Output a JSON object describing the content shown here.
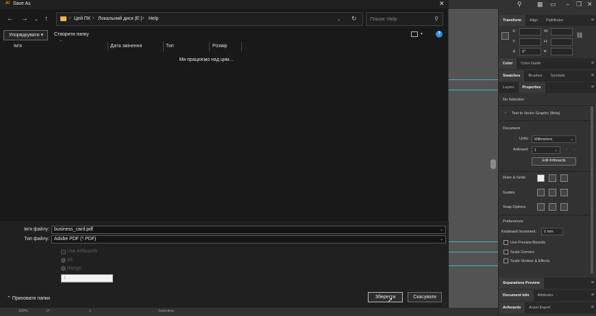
{
  "dialog": {
    "title": "Save As",
    "app_badge": "Ai",
    "close_glyph": "✕",
    "breadcrumb": [
      "Цей ПК",
      "Локальний диск (E:)",
      "Help"
    ],
    "search_placeholder": "Пошук: Help",
    "organize_label": "Упорядкувати ▾",
    "new_folder_label": "Створити папку",
    "help_glyph": "?",
    "columns": [
      "Ім'я",
      "Дата змінення",
      "Тип",
      "Розмір"
    ],
    "empty_message": "Ми працюємо над цим...",
    "filename_label": "Ім'я файлу:",
    "filename_value": "business_card.pdf",
    "filetype_label": "Тип файлу:",
    "filetype_value": "Adobe PDF (*.PDF)",
    "use_artboards_label": "Use Artboards",
    "all_label": "All",
    "range_label": "Range:",
    "range_value": "1",
    "hide_folders_label": "Приховати папки",
    "save_label": "Зберегти",
    "cancel_label": "Скасувати",
    "icons": [
      "back-icon",
      "forward-icon",
      "recent-icon",
      "up-icon",
      "folder-icon",
      "refresh-icon",
      "search-icon",
      "view-icon",
      "help-icon",
      "close-icon"
    ]
  },
  "panel": {
    "top_tabs": [
      "Transform",
      "Align",
      "Pathfinder"
    ],
    "transform_fields": {
      "x": "X:",
      "y": "Y:",
      "w": "W:",
      "h": "H:",
      "angle": "0°"
    },
    "color_tabs": [
      "Color",
      "Color Guide"
    ],
    "swatch_tabs": [
      "Swatches",
      "Brushes",
      "Symbols"
    ],
    "props_tabs": [
      "Layers",
      "Properties"
    ],
    "no_selection": "No Selection",
    "text_to_vector": "Text to Vector Graphic (Beta)",
    "document": "Document",
    "units_label": "Units:",
    "units_value": "Millimeters",
    "artboard_label": "Artboard:",
    "artboard_value": "1",
    "edit_artboards": "Edit Artboards",
    "rulers_grids": "Ruler & Grids",
    "guides": "Guides",
    "snap_options": "Snap Options",
    "preferences": "Preferences",
    "keyboard_increment_label": "Keyboard Increment:",
    "keyboard_increment_value": "0 mm",
    "use_preview_bounds": "Use Preview Bounds",
    "scale_corners": "Scale Corners",
    "scale_strokes": "Scale Strokes & Effects",
    "sep_preview_tab": "Separations Preview",
    "doc_info_tabs": [
      "Document Info",
      "Attributes"
    ],
    "artboards_tabs": [
      "Artboards",
      "Asset Export"
    ]
  },
  "status": {
    "zoom": "200%",
    "rotation": "0°",
    "artboard_nav": "1",
    "tool": "Selection"
  }
}
